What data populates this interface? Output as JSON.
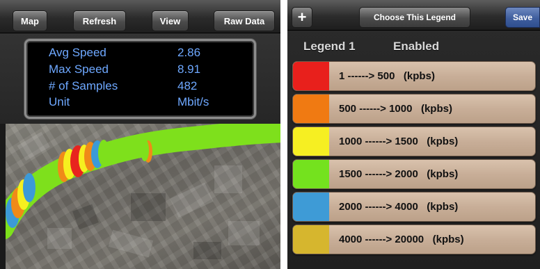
{
  "left_panel": {
    "toolbar": {
      "map_label": "Map",
      "refresh_label": "Refresh",
      "view_label": "View",
      "raw_data_label": "Raw Data"
    },
    "stats": [
      {
        "label": "Avg Speed",
        "value": "2.86"
      },
      {
        "label": "Max Speed",
        "value": "8.91"
      },
      {
        "label": "# of Samples",
        "value": "482"
      },
      {
        "label": "Unit",
        "value": "Mbit/s"
      }
    ],
    "map": {
      "track_colors": {
        "green": "#7ee01c",
        "yellow": "#f6ef1f",
        "orange": "#f08a18",
        "red": "#e8241e",
        "blue": "#3c9ad8"
      }
    }
  },
  "right_panel": {
    "toolbar": {
      "add_icon": "plus-icon",
      "add_label": "+",
      "choose_label": "Choose This Legend",
      "save_label": "Save"
    },
    "legend_name": "Legend 1",
    "legend_status": "Enabled",
    "legend_items": [
      {
        "label": "1 ------> 500   (kpbs)",
        "color": "#e8201c"
      },
      {
        "label": "500 ------> 1000   (kpbs)",
        "color": "#f07a12"
      },
      {
        "label": "1000 ------> 1500   (kpbs)",
        "color": "#f6ef22"
      },
      {
        "label": "1500 ------> 2000   (kpbs)",
        "color": "#74e21e"
      },
      {
        "label": "2000 ------> 4000   (kpbs)",
        "color": "#3e9bd6"
      },
      {
        "label": "4000 ------> 20000   (kpbs)",
        "color": "#d6b62e"
      }
    ]
  }
}
